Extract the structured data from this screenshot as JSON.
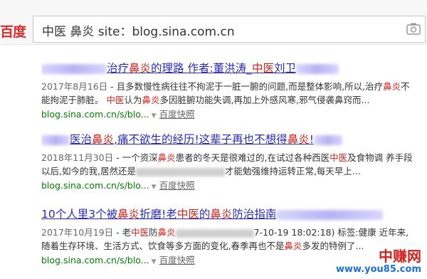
{
  "header": {
    "logo": "百度",
    "query": "中医 鼻炎 site：blog.sina.com.cn"
  },
  "results": [
    {
      "title_parts": [
        "治疗",
        "鼻炎",
        "的理路 作者:董洪涛_",
        "中医",
        "刘卫"
      ],
      "abstract_line1": [
        "2017年8月16日",
        " - 且多数慢性病往往不拘泥于一脏一腑的问题,而是整体影响,所以,治疗",
        "鼻炎",
        "不"
      ],
      "abstract_line2": [
        "能拘泥于肺脏。 ",
        "中医",
        "认为",
        "鼻炎",
        "多因脏腑功能失调,再加上外感风寒,邪气侵袭鼻窍而..."
      ],
      "url": "blog.sina.com.cn/s/blo...",
      "snapshot": "百度快照"
    },
    {
      "title_parts": [
        "医治",
        "鼻炎",
        ",痛不欲生的经历!这辈子再也不想得",
        "鼻炎",
        "!"
      ],
      "abstract_line1": [
        "2018年11月30日",
        " - 一个资深",
        "鼻炎",
        "患者的冬天是很难过的,在试过各种西医",
        "中医",
        "及食物调 养手段"
      ],
      "abstract_line2": [
        "以后,如今的我,居然还是",
        "才能勉强维持运转正常,每天早上..."
      ],
      "url": "blog.sina.com.cn/s/blo...",
      "snapshot": "百度快照"
    },
    {
      "title_parts": [
        "10个人里3个被",
        "鼻炎",
        "折磨!老",
        "中医",
        "的",
        "鼻炎",
        "防治指南"
      ],
      "abstract_line1": [
        "2017年10月19日",
        " - 老",
        "中医",
        "防",
        "鼻炎",
        "7-10-19 18:02:18) 标签:健康 近年来,"
      ],
      "abstract_line2": [
        "随着生存环境、生活方式、饮食等多方面的变化,春季再也不是",
        "鼻炎",
        "多发的特例了..."
      ],
      "url": "blog.sina.com.cn/s/blo...",
      "snapshot": "百度快照"
    }
  ],
  "watermark": {
    "name": "中赚网",
    "url": "www.you85.com"
  },
  "colors": {
    "link": "#2a2ac0",
    "highlight": "#d3221d",
    "url": "#008000",
    "logo": "#e02b2b"
  }
}
